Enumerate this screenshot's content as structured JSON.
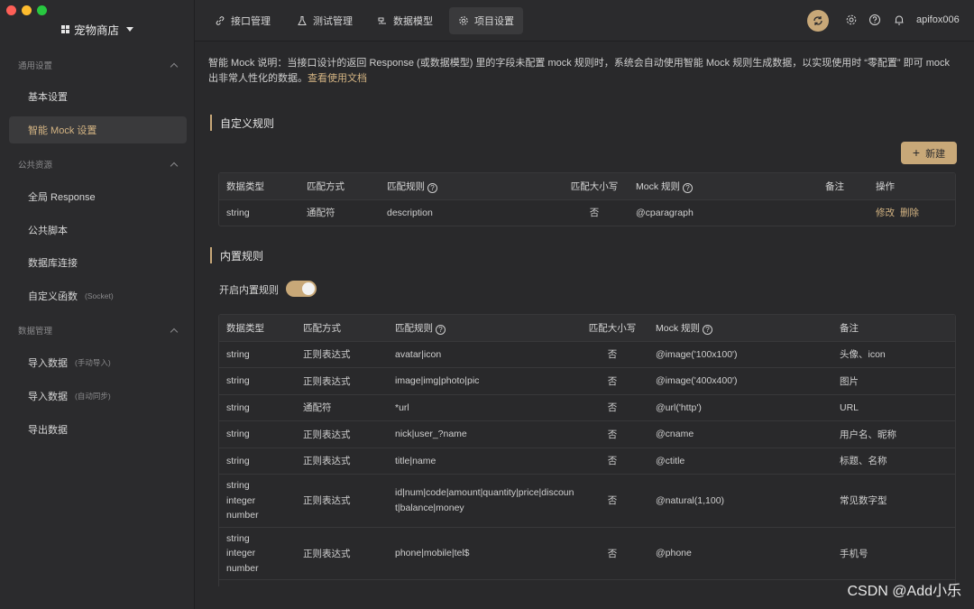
{
  "window": {
    "project_name": "宠物商店"
  },
  "sidebar": {
    "sections": [
      {
        "title": "通用设置",
        "items": [
          {
            "label": "基本设置",
            "sub": ""
          },
          {
            "label": "智能 Mock 设置",
            "sub": "",
            "active": true
          }
        ]
      },
      {
        "title": "公共资源",
        "items": [
          {
            "label": "全局 Response",
            "sub": ""
          },
          {
            "label": "公共脚本",
            "sub": ""
          },
          {
            "label": "数据库连接",
            "sub": ""
          },
          {
            "label": "自定义函数",
            "sub": "(Socket)"
          }
        ]
      },
      {
        "title": "数据管理",
        "items": [
          {
            "label": "导入数据",
            "sub": "(手动导入)"
          },
          {
            "label": "导入数据",
            "sub": "(自动同步)"
          },
          {
            "label": "导出数据",
            "sub": ""
          }
        ]
      }
    ]
  },
  "topbar": {
    "tabs": [
      {
        "label": "接口管理",
        "icon": "link-icon"
      },
      {
        "label": "测试管理",
        "icon": "flask-icon"
      },
      {
        "label": "数据模型",
        "icon": "model-icon"
      },
      {
        "label": "项目设置",
        "icon": "gear-icon",
        "active": true
      }
    ],
    "username": "apifox006"
  },
  "main": {
    "description": "智能 Mock 说明：当接口设计的返回 Response (或数据模型) 里的字段未配置 mock 规则时，系统会自动使用智能 Mock 规则生成数据，以实现使用时 “零配置” 即可 mock 出非常人性化的数据。",
    "doc_link": "查看使用文档",
    "custom_rules": {
      "title": "自定义规则",
      "new_button": "新建",
      "columns": [
        "数据类型",
        "匹配方式",
        "匹配规则",
        "匹配大小写",
        "Mock 规则",
        "备注",
        "操作"
      ],
      "rows": [
        {
          "type": "string",
          "method": "通配符",
          "rule": "description",
          "case": "否",
          "mock": "@cparagraph",
          "note": "",
          "edit": "修改",
          "delete": "删除"
        }
      ]
    },
    "builtin_rules": {
      "title": "内置规则",
      "toggle_label": "开启内置规则",
      "toggle_on": true,
      "columns": [
        "数据类型",
        "匹配方式",
        "匹配规则",
        "匹配大小写",
        "Mock 规则",
        "备注"
      ],
      "rows": [
        {
          "type": "string",
          "method": "正则表达式",
          "rule": "avatar|icon",
          "case": "否",
          "mock": "@image('100x100')",
          "note": "头像、icon"
        },
        {
          "type": "string",
          "method": "正则表达式",
          "rule": "image|img|photo|pic",
          "case": "否",
          "mock": "@image('400x400')",
          "note": "图片"
        },
        {
          "type": "string",
          "method": "通配符",
          "rule": "*url",
          "case": "否",
          "mock": "@url('http')",
          "note": "URL"
        },
        {
          "type": "string",
          "method": "正则表达式",
          "rule": "nick|user_?name",
          "case": "否",
          "mock": "@cname",
          "note": "用户名、昵称"
        },
        {
          "type": "string",
          "method": "正则表达式",
          "rule": "title|name",
          "case": "否",
          "mock": "@ctitle",
          "note": "标题、名称"
        },
        {
          "type": "string\ninteger\nnumber",
          "method": "正则表达式",
          "rule": "id|num|code|amount|quantity|price|discount|balance|money",
          "case": "否",
          "mock": "@natural(1,100)",
          "note": "常见数字型"
        },
        {
          "type": "string\ninteger\nnumber",
          "method": "正则表达式",
          "rule": "phone|mobile|tel$",
          "case": "否",
          "mock": "@phone",
          "note": "手机号"
        }
      ]
    }
  },
  "watermark": "CSDN @Add小乐",
  "colors": {
    "accent": "#c8a878",
    "accent_text": "#d4b483",
    "bg": "#29292b",
    "sidebar": "#2b2b2d"
  }
}
